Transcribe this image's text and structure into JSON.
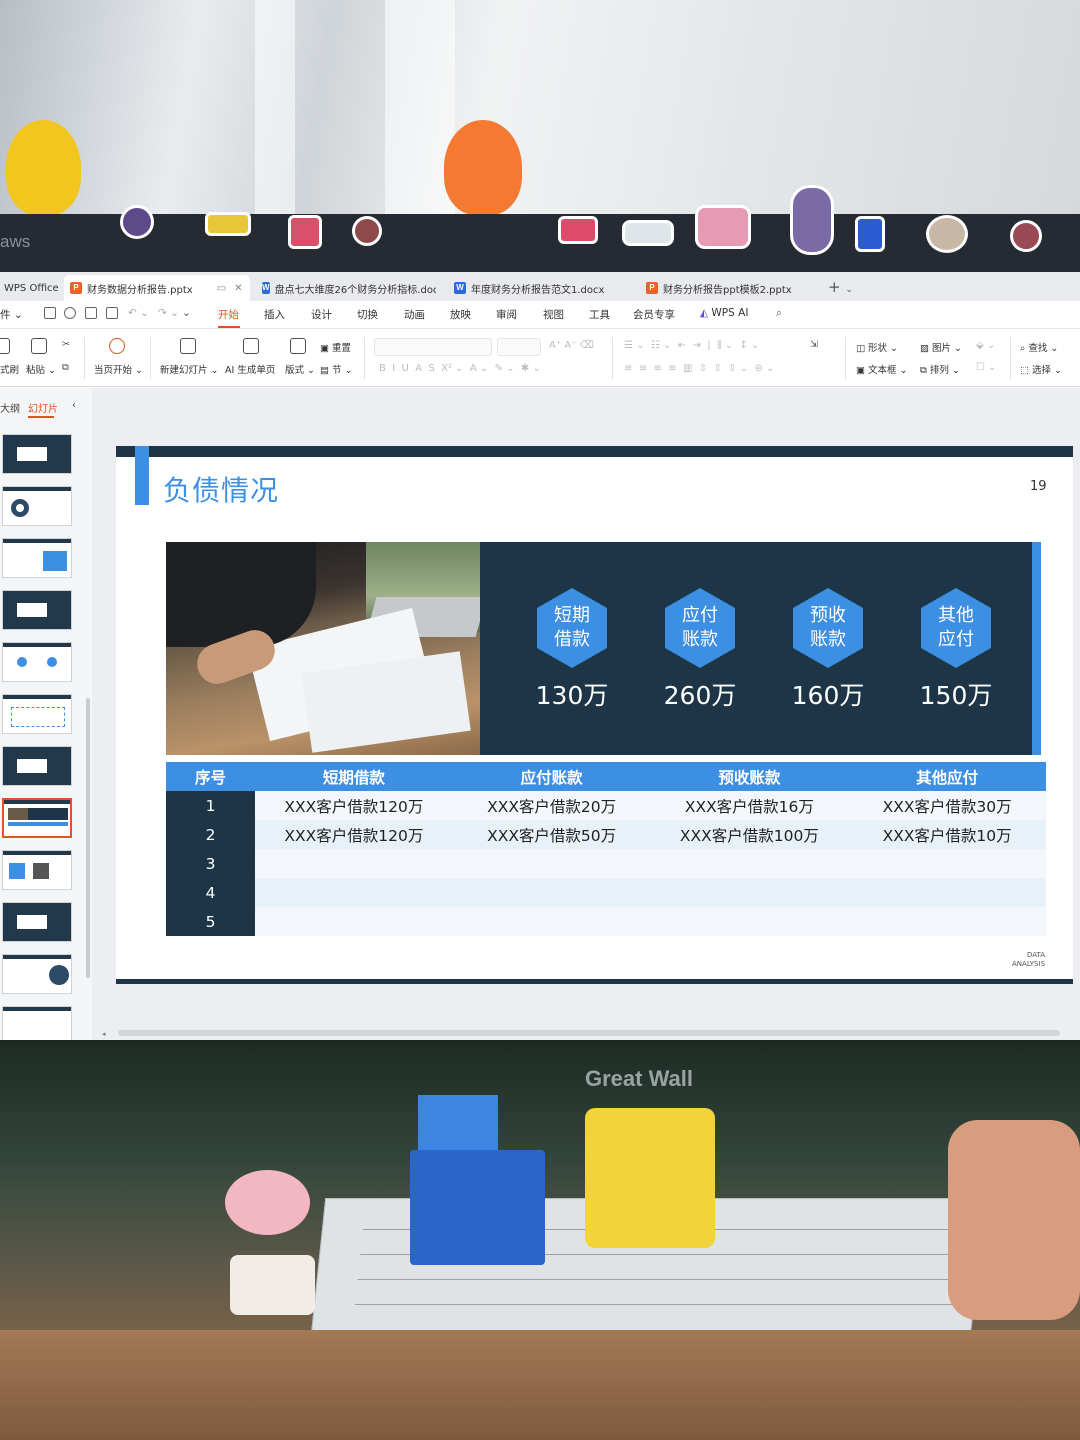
{
  "bezel": {
    "brand": "aws"
  },
  "tabs": [
    {
      "label": "WPS Office",
      "icon": "wps-home-icon"
    },
    {
      "label": "财务数据分析报告.pptx",
      "icon": "ppt-file-icon",
      "active": true
    },
    {
      "label": "盘点七大维度26个财务分析指标.doc",
      "icon": "word-file-icon"
    },
    {
      "label": "年度财务分析报告范文1.docx",
      "icon": "word-file-icon"
    },
    {
      "label": "财务分析报告ppt模板2.pptx",
      "icon": "ppt-file-icon"
    }
  ],
  "menu": {
    "file": "件",
    "items": [
      "开始",
      "插入",
      "设计",
      "切换",
      "动画",
      "放映",
      "审阅",
      "视图",
      "工具",
      "会员专享",
      "WPS AI"
    ],
    "active": "开始"
  },
  "ribbon": {
    "format_painter": "式刷",
    "paste": "粘贴",
    "from_current": "当页开始",
    "new_slide": "新建幻灯片",
    "ai_single": "AI 生成单页",
    "layout": "版式",
    "reset": "重置",
    "section": "节",
    "shape": "形状",
    "textbox": "文本框",
    "picture": "图片",
    "arrange": "排列",
    "find": "查找",
    "select": "选择"
  },
  "pane": {
    "outline": "大纲",
    "slides": "幻灯片"
  },
  "slide": {
    "title": "负债情况",
    "page_number": "19",
    "footer": [
      "DATA",
      "ANALYSIS"
    ],
    "kpis": [
      {
        "line1": "短期",
        "line2": "借款",
        "value": "130万"
      },
      {
        "line1": "应付",
        "line2": "账款",
        "value": "260万"
      },
      {
        "line1": "预收",
        "line2": "账款",
        "value": "160万"
      },
      {
        "line1": "其他",
        "line2": "应付",
        "value": "150万"
      }
    ],
    "table": {
      "headers": [
        "序号",
        "短期借款",
        "应付账款",
        "预收账款",
        "其他应付"
      ],
      "rows": [
        [
          "1",
          "XXX客户借款120万",
          "XXX客户借款20万",
          "XXX客户借款16万",
          "XXX客户借款30万"
        ],
        [
          "2",
          "XXX客户借款120万",
          "XXX客户借款50万",
          "XXX客户借款100万",
          "XXX客户借款10万"
        ],
        [
          "3",
          "",
          "",
          "",
          ""
        ],
        [
          "4",
          "",
          "",
          "",
          ""
        ],
        [
          "5",
          "",
          "",
          "",
          ""
        ]
      ]
    }
  },
  "desk": {
    "monitor_brand": "Great Wall"
  },
  "colors": {
    "slide_navy": "#1d3547",
    "slide_blue": "#3d8fe3",
    "accent_orange": "#e0531f"
  }
}
